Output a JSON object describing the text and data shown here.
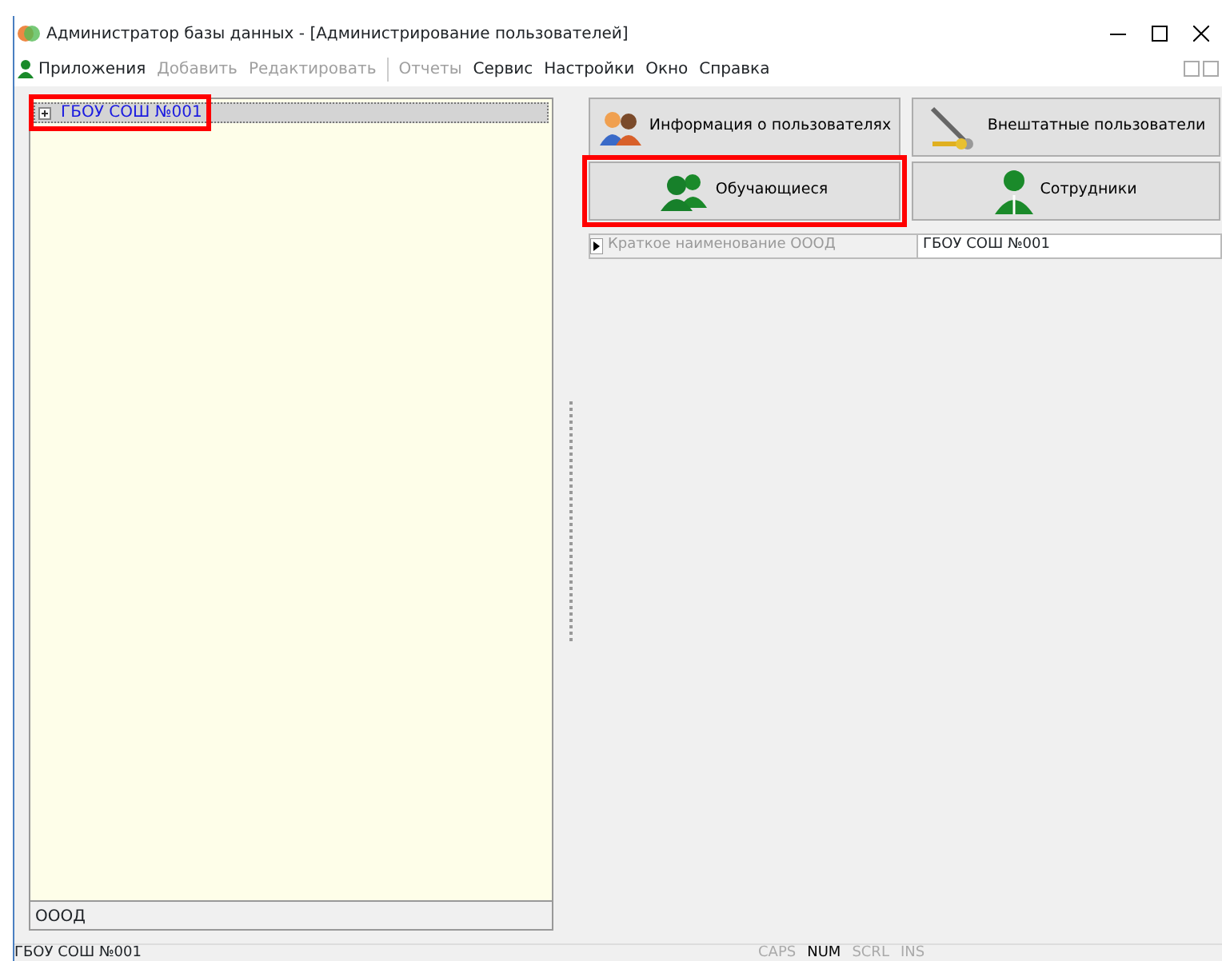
{
  "window": {
    "title": "Администратор базы данных - [Администрирование пользователей]"
  },
  "menu": [
    {
      "label": "Приложения",
      "disabled": false,
      "kind": "app"
    },
    {
      "label": "Добавить",
      "disabled": true,
      "kind": "item"
    },
    {
      "label": "Редактировать",
      "disabled": true,
      "kind": "item"
    },
    {
      "label": "Отчеты",
      "disabled": true,
      "kind": "separated"
    },
    {
      "label": "Сервис",
      "disabled": false,
      "kind": "item"
    },
    {
      "label": "Настройки",
      "disabled": false,
      "kind": "item"
    },
    {
      "label": "Окно",
      "disabled": false,
      "kind": "item"
    },
    {
      "label": "Справка",
      "disabled": false,
      "kind": "item"
    }
  ],
  "tree": {
    "items": [
      {
        "label": "ГБОУ СОШ №001",
        "selected": true,
        "highlighted": true
      }
    ],
    "footer": "ОООД"
  },
  "buttons": [
    {
      "label": "Информация о пользователях",
      "kind": "people",
      "highlighted": false
    },
    {
      "label": "Внештатные пользователи",
      "kind": "keys",
      "highlighted": false
    },
    {
      "label": "Обучающиеся",
      "kind": "group",
      "highlighted": true
    },
    {
      "label": "Сотрудники",
      "kind": "person",
      "highlighted": false
    }
  ],
  "property_grid": [
    {
      "name": "Краткое наименование ОООД",
      "value": "ГБОУ СОШ №001"
    }
  ],
  "status_bar": {
    "text": "ГБОУ СОШ №001",
    "indicators": [
      {
        "label": "CAPS",
        "on": false
      },
      {
        "label": "NUM",
        "on": true
      },
      {
        "label": "SCRL",
        "on": false
      },
      {
        "label": "INS",
        "on": false
      }
    ]
  }
}
